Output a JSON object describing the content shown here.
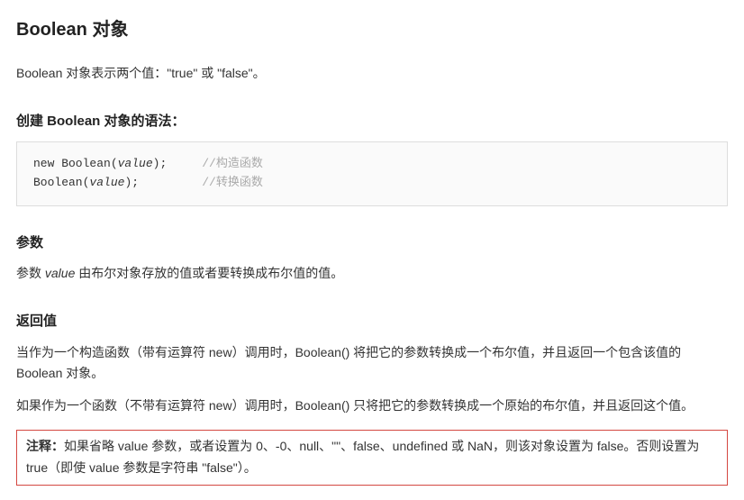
{
  "title": "Boolean 对象",
  "intro": "Boolean 对象表示两个值：\"true\" 或 \"false\"。",
  "syntax_heading": "创建 Boolean 对象的语法：",
  "code": {
    "line1_code": "new Boolean(",
    "line1_param": "value",
    "line1_code_end": ");",
    "line1_comment": "//构造函数",
    "line2_code": "Boolean(",
    "line2_param": "value",
    "line2_code_end": ");",
    "line2_comment": "//转换函数"
  },
  "params_heading": "参数",
  "params_text_pre": "参数 ",
  "params_text_ital": "value",
  "params_text_post": " 由布尔对象存放的值或者要转换成布尔值的值。",
  "return_heading": "返回值",
  "return_p1": "当作为一个构造函数（带有运算符 new）调用时，Boolean() 将把它的参数转换成一个布尔值，并且返回一个包含该值的 Boolean 对象。",
  "return_p2": "如果作为一个函数（不带有运算符 new）调用时，Boolean() 只将把它的参数转换成一个原始的布尔值，并且返回这个值。",
  "note_label": "注释：",
  "note_text": "如果省略 value 参数，或者设置为 0、-0、null、\"\"、false、undefined 或 NaN，则该对象设置为 false。否则设置为 true（即使 value 参数是字符串 \"false\"）。"
}
